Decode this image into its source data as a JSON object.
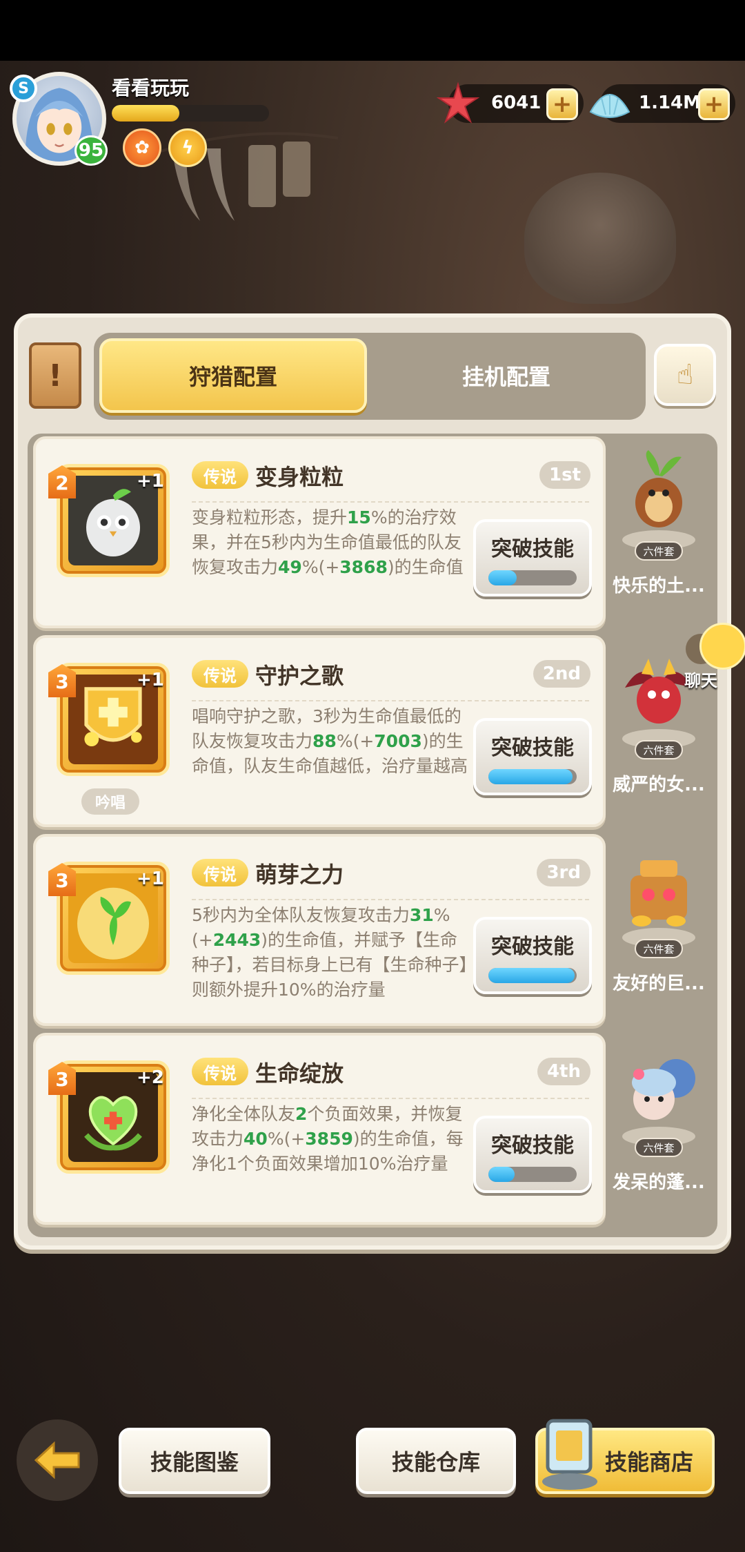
{
  "player": {
    "name": "看看玩玩",
    "level": "95",
    "xp_fraction": 0.43,
    "avatar_badge": "S"
  },
  "currency": {
    "starfish": "6041",
    "shell": "1.14M"
  },
  "tabs": [
    {
      "label": "狩猎配置",
      "active": true
    },
    {
      "label": "挂机配置",
      "active": false
    }
  ],
  "skills": [
    {
      "level": "2",
      "plus": "+1",
      "rarity": "传说",
      "name": "变身粒粒",
      "rank": "1st",
      "desc": [
        "变身粒粒形态，提升",
        "15",
        "%的治疗效果，并在5秒内为生命值最低的队友恢复攻击力",
        "49",
        "%(+",
        "3868",
        ")的生命值"
      ],
      "button": "突破技能",
      "progress": 0.32,
      "chant": ""
    },
    {
      "level": "3",
      "plus": "+1",
      "rarity": "传说",
      "name": "守护之歌",
      "rank": "2nd",
      "desc": [
        "唱响守护之歌，3秒为生命值最低的队友恢复攻击力",
        "88",
        "%(+",
        "7003",
        ")的生命值，队友生命值越低，治疗量越高"
      ],
      "button": "突破技能",
      "progress": 0.95,
      "chant": "吟唱"
    },
    {
      "level": "3",
      "plus": "+1",
      "rarity": "传说",
      "name": "萌芽之力",
      "rank": "3rd",
      "desc": [
        "5秒内为全体队友恢复攻击力",
        "31",
        "%(+",
        "2443",
        ")的生命值，并赋予【生命种子】，若目标身上已有【生命种子】则额外提升10%的治疗量"
      ],
      "button": "突破技能",
      "progress": 0.98,
      "chant": ""
    },
    {
      "level": "3",
      "plus": "+2",
      "rarity": "传说",
      "name": "生命绽放",
      "rank": "4th",
      "desc": [
        "净化全体队友",
        "2",
        "个负面效果，并恢复攻击力",
        "40",
        "%(+",
        "3859",
        ")的生命值，每净化1个负面效果增加10%治疗量"
      ],
      "button": "突破技能",
      "progress": 0.3,
      "chant": ""
    }
  ],
  "heroes": [
    {
      "tag": "六件套",
      "name": "快乐的土..."
    },
    {
      "tag": "六件套",
      "name": "威严的女..."
    },
    {
      "tag": "六件套",
      "name": "友好的巨..."
    },
    {
      "tag": "六件套",
      "name": "发呆的蓬..."
    }
  ],
  "chat": {
    "label": "聊天"
  },
  "bottom": {
    "codex": "技能图鉴",
    "storage": "技能仓库",
    "shop": "技能商店"
  },
  "colors": {
    "gold": "#f3c54c",
    "green_highlight": "#2fa14a",
    "progress_blue": "#29a7e6"
  }
}
